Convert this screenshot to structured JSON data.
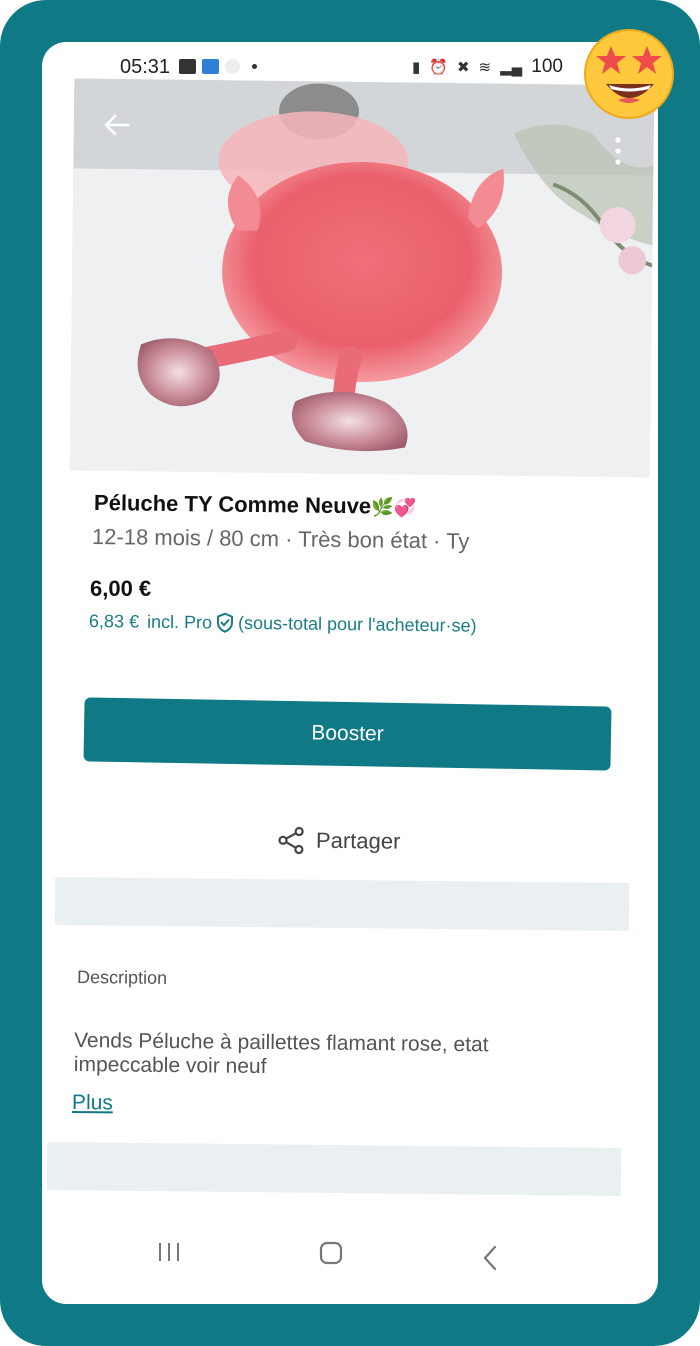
{
  "status_bar": {
    "time": "05:31",
    "battery": "100"
  },
  "listing": {
    "title": "Péluche TY Comme Neuve",
    "title_emojis": "🌿💞",
    "subtitle": "12-18 mois / 80 cm · Très bon état · Ty",
    "price": "6,00 €",
    "pro_price": "6,83 €",
    "pro_label": "incl. Pro",
    "pro_note": "(sous-total pour l'acheteur·se)"
  },
  "actions": {
    "booster_label": "Booster",
    "share_label": "Partager"
  },
  "description": {
    "label": "Description",
    "text": "Vends Péluche à paillettes flamant rose, etat impeccable voir neuf",
    "more_label": "Plus"
  },
  "colors": {
    "brand": "#0f7a85",
    "frame": "#0f7a85",
    "divider": "#eaf0f1"
  },
  "icons": {
    "back": "arrow-left-icon",
    "more": "more-vertical-icon",
    "shield": "shield-check-icon",
    "share": "share-icon",
    "emoji": "star-struck-emoji"
  }
}
